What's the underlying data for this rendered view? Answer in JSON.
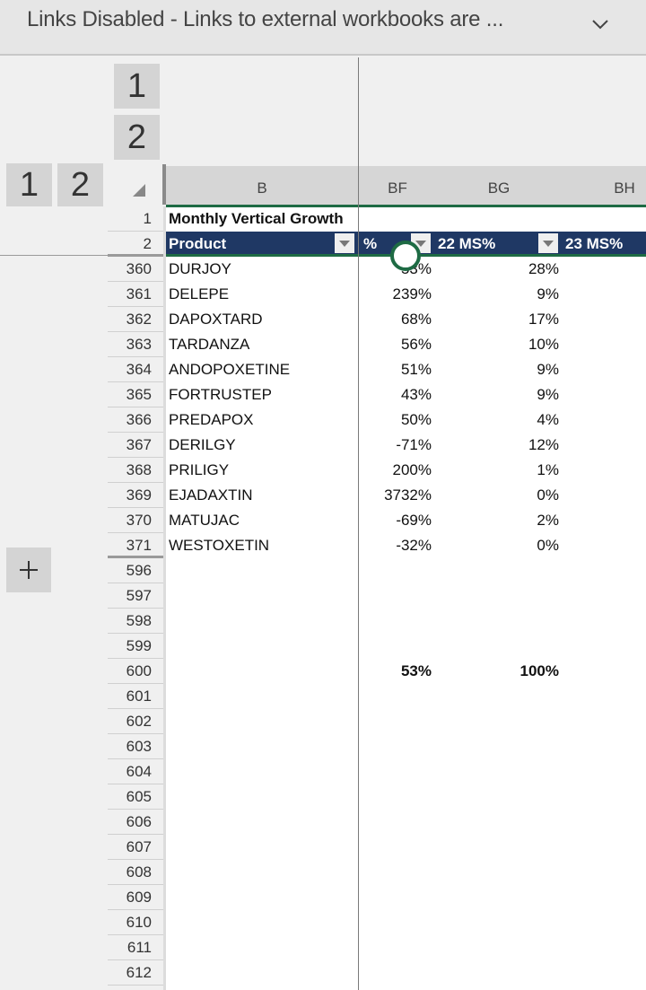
{
  "banner": {
    "text": "Links Disabled - Links to external workbooks are ...",
    "expand_icon": "chevron-down-icon"
  },
  "outline": {
    "column_levels": [
      "1",
      "2"
    ],
    "row_levels": [
      "1",
      "2"
    ],
    "expand_icon": "plus-icon"
  },
  "columns": [
    "B",
    "BF",
    "BG",
    "BH"
  ],
  "sheet": {
    "title_row": {
      "row": "1",
      "text": "Monthly Vertical Growth"
    },
    "header_row": {
      "row": "2",
      "headers": [
        "Product",
        "%",
        "22 MS%",
        "23 MS%"
      ]
    },
    "rows": [
      {
        "row": "360",
        "product": "DURJOY",
        "pct": "53%",
        "ms22": "28%"
      },
      {
        "row": "361",
        "product": "DELEPE",
        "pct": "239%",
        "ms22": "9%"
      },
      {
        "row": "362",
        "product": "DAPOXTARD",
        "pct": "68%",
        "ms22": "17%"
      },
      {
        "row": "363",
        "product": "TARDANZA",
        "pct": "56%",
        "ms22": "10%"
      },
      {
        "row": "364",
        "product": "ANDOPOXETINE",
        "pct": "51%",
        "ms22": "9%"
      },
      {
        "row": "365",
        "product": "FORTRUSTEP",
        "pct": "43%",
        "ms22": "9%"
      },
      {
        "row": "366",
        "product": "PREDAPOX",
        "pct": "50%",
        "ms22": "4%"
      },
      {
        "row": "367",
        "product": "DERILGY",
        "pct": "-71%",
        "ms22": "12%"
      },
      {
        "row": "368",
        "product": "PRILIGY",
        "pct": "200%",
        "ms22": "1%"
      },
      {
        "row": "369",
        "product": "EJADAXTIN",
        "pct": "3732%",
        "ms22": "0%"
      },
      {
        "row": "370",
        "product": "MATUJAC",
        "pct": "-69%",
        "ms22": "2%"
      },
      {
        "row": "371",
        "product": "WESTOXETIN",
        "pct": "-32%",
        "ms22": "0%"
      }
    ],
    "empty_rows": [
      "596",
      "597",
      "598",
      "599"
    ],
    "total_row": {
      "row": "600",
      "pct": "53%",
      "ms22": "100%"
    },
    "trailing_rows": [
      "601",
      "602",
      "603",
      "604",
      "605",
      "606",
      "607",
      "608",
      "609",
      "610",
      "611",
      "612"
    ]
  },
  "colors": {
    "table_header_bg": "#1f3864",
    "selection_green": "#1e6b44",
    "banner_bg": "#e6e6e6"
  }
}
